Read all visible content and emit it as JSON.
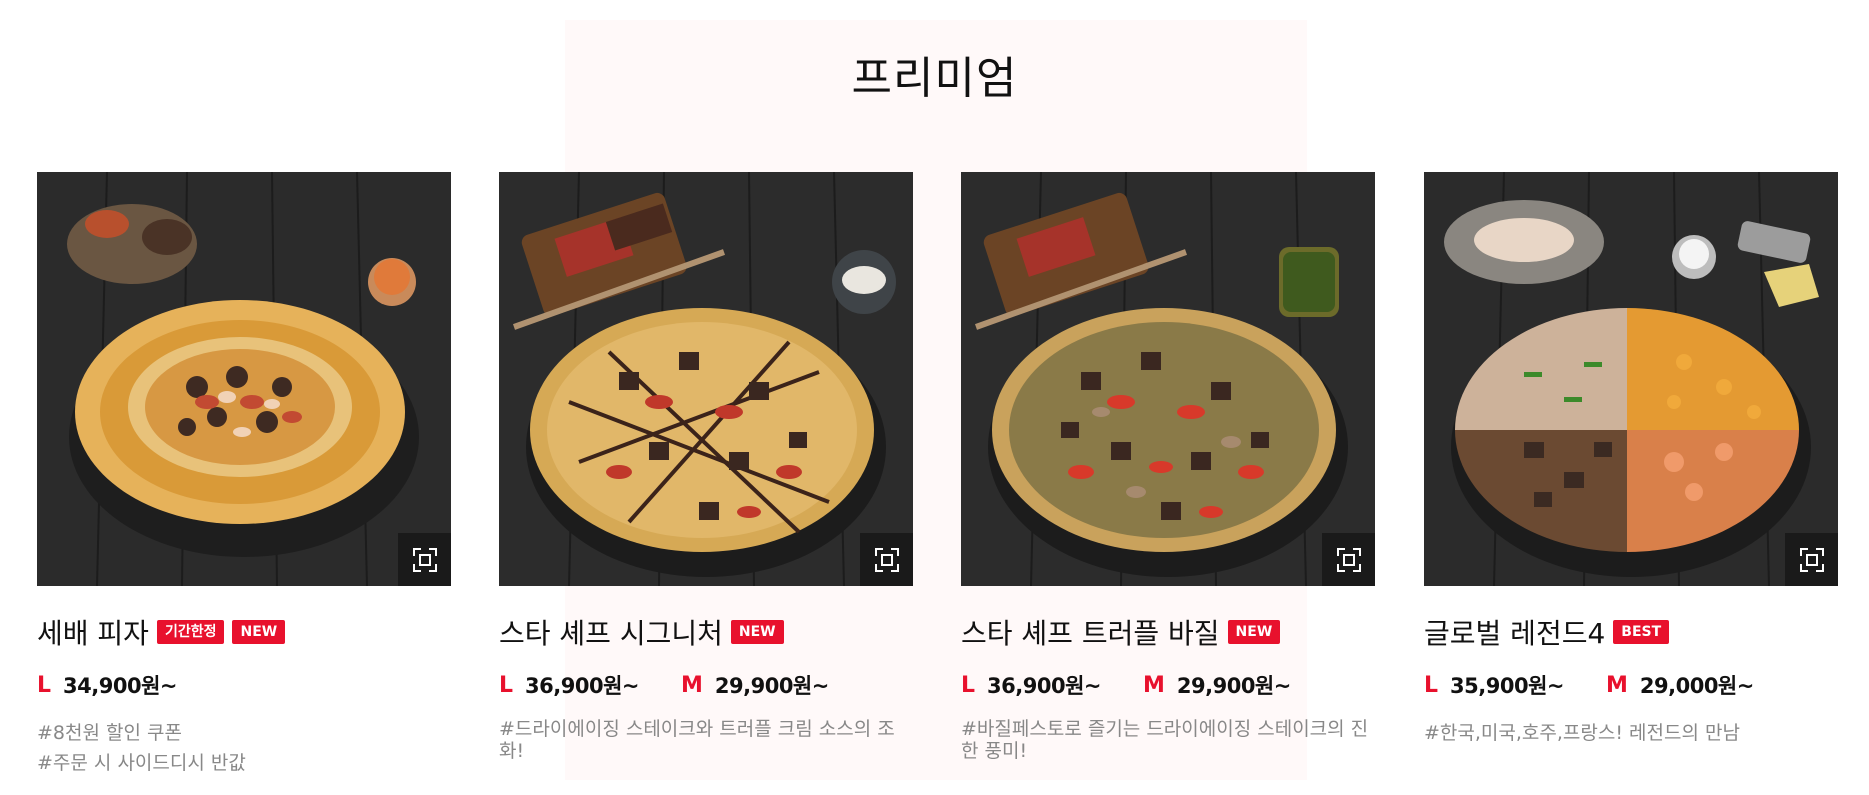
{
  "section": {
    "title": "프리미엄"
  },
  "products": [
    {
      "name": "세배 피자",
      "badges": [
        "기간한정",
        "NEW"
      ],
      "prices": [
        {
          "size": "L",
          "amount": "34,900원~"
        }
      ],
      "desc": [
        "#8천원 할인 쿠폰",
        "#주문 시 사이드디시 반값"
      ]
    },
    {
      "name": "스타 셰프 시그니처",
      "badges": [
        "NEW"
      ],
      "prices": [
        {
          "size": "L",
          "amount": "36,900원~"
        },
        {
          "size": "M",
          "amount": "29,900원~"
        }
      ],
      "desc": [
        "#드라이에이징 스테이크와 트러플 크림 소스의 조화!"
      ]
    },
    {
      "name": "스타 셰프 트러플 바질",
      "badges": [
        "NEW"
      ],
      "prices": [
        {
          "size": "L",
          "amount": "36,900원~"
        },
        {
          "size": "M",
          "amount": "29,900원~"
        }
      ],
      "desc": [
        "#바질페스토로 즐기는 드라이에이징 스테이크의 진한 풍미!"
      ]
    },
    {
      "name": "글로벌 레전드4",
      "badges": [
        "BEST"
      ],
      "prices": [
        {
          "size": "L",
          "amount": "35,900원~"
        },
        {
          "size": "M",
          "amount": "29,000원~"
        }
      ],
      "desc": [
        "#한국,미국,호주,프랑스! 레전드의 만남"
      ]
    }
  ],
  "colors": {
    "accent": "#e8112d",
    "text": "#111111",
    "muted": "#888888"
  },
  "icons": {
    "zoom": "expand-icon"
  }
}
